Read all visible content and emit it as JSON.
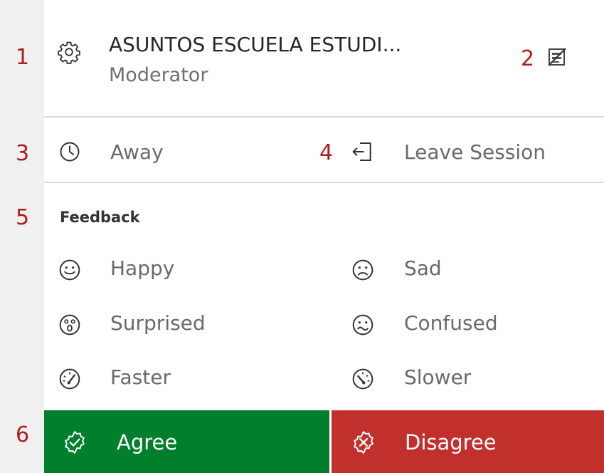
{
  "callouts": [
    "1",
    "2",
    "3",
    "4",
    "5",
    "6"
  ],
  "session": {
    "title": "ASUNTOS ESCUELA ESTUDI...",
    "role": "Moderator",
    "settings_icon": "gear-icon",
    "caption_icon": "caption-edit-icon"
  },
  "status": {
    "away_label": "Away",
    "away_icon": "clock-icon",
    "leave_label": "Leave Session",
    "leave_icon": "exit-door-icon"
  },
  "feedback": {
    "title": "Feedback",
    "items": [
      {
        "label": "Happy",
        "icon": "happy-face-icon"
      },
      {
        "label": "Sad",
        "icon": "sad-face-icon"
      },
      {
        "label": "Surprised",
        "icon": "surprised-face-icon"
      },
      {
        "label": "Confused",
        "icon": "confused-face-icon"
      },
      {
        "label": "Faster",
        "icon": "speedometer-fast-icon"
      },
      {
        "label": "Slower",
        "icon": "speedometer-slow-icon"
      }
    ],
    "agree_label": "Agree",
    "disagree_label": "Disagree",
    "colors": {
      "agree": "#027f2c",
      "disagree": "#c2302d",
      "callout": "#b31b1b"
    }
  }
}
